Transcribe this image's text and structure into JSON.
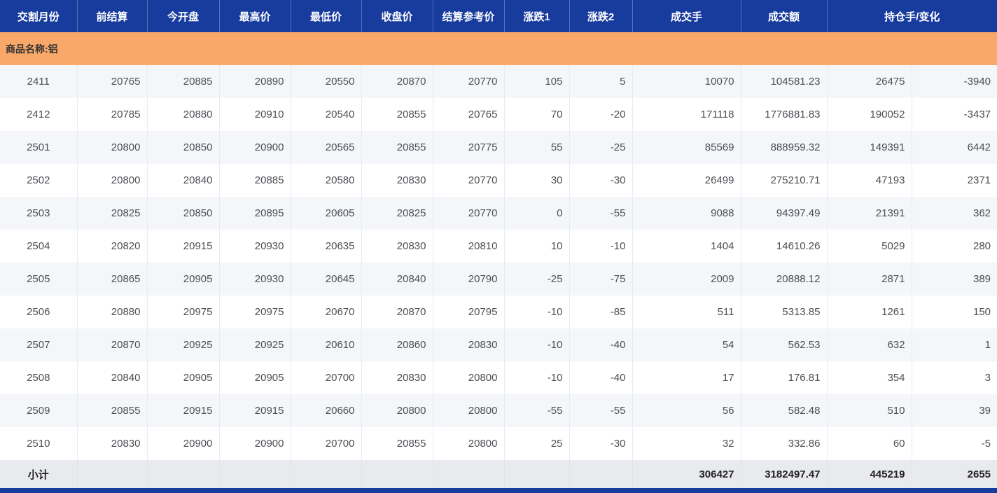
{
  "colors": {
    "header_bg": "#183b9e",
    "header_text": "#ffffff",
    "group_row_bg": "#f9a869",
    "row_alt_bg": "#f4f6fa",
    "row_bg": "#ffffff",
    "subtotal_bg": "#e9eaed",
    "cell_text": "#4c4f54"
  },
  "table": {
    "columns": [
      "交割月份",
      "前结算",
      "今开盘",
      "最高价",
      "最低价",
      "收盘价",
      "结算参考价",
      "涨跌1",
      "涨跌2",
      "成交手",
      "成交额",
      "持仓手/变化"
    ],
    "group_label": "商品名称:铝",
    "rows": [
      [
        "2411",
        "20765",
        "20885",
        "20890",
        "20550",
        "20870",
        "20770",
        "105",
        "5",
        "10070",
        "104581.23",
        "26475",
        "-3940"
      ],
      [
        "2412",
        "20785",
        "20880",
        "20910",
        "20540",
        "20855",
        "20765",
        "70",
        "-20",
        "171118",
        "1776881.83",
        "190052",
        "-3437"
      ],
      [
        "2501",
        "20800",
        "20850",
        "20900",
        "20565",
        "20855",
        "20775",
        "55",
        "-25",
        "85569",
        "888959.32",
        "149391",
        "6442"
      ],
      [
        "2502",
        "20800",
        "20840",
        "20885",
        "20580",
        "20830",
        "20770",
        "30",
        "-30",
        "26499",
        "275210.71",
        "47193",
        "2371"
      ],
      [
        "2503",
        "20825",
        "20850",
        "20895",
        "20605",
        "20825",
        "20770",
        "0",
        "-55",
        "9088",
        "94397.49",
        "21391",
        "362"
      ],
      [
        "2504",
        "20820",
        "20915",
        "20930",
        "20635",
        "20830",
        "20810",
        "10",
        "-10",
        "1404",
        "14610.26",
        "5029",
        "280"
      ],
      [
        "2505",
        "20865",
        "20905",
        "20930",
        "20645",
        "20840",
        "20790",
        "-25",
        "-75",
        "2009",
        "20888.12",
        "2871",
        "389"
      ],
      [
        "2506",
        "20880",
        "20975",
        "20975",
        "20670",
        "20870",
        "20795",
        "-10",
        "-85",
        "511",
        "5313.85",
        "1261",
        "150"
      ],
      [
        "2507",
        "20870",
        "20925",
        "20925",
        "20610",
        "20860",
        "20830",
        "-10",
        "-40",
        "54",
        "562.53",
        "632",
        "1"
      ],
      [
        "2508",
        "20840",
        "20905",
        "20905",
        "20700",
        "20830",
        "20800",
        "-10",
        "-40",
        "17",
        "176.81",
        "354",
        "3"
      ],
      [
        "2509",
        "20855",
        "20915",
        "20915",
        "20660",
        "20800",
        "20800",
        "-55",
        "-55",
        "56",
        "582.48",
        "510",
        "39"
      ],
      [
        "2510",
        "20830",
        "20900",
        "20900",
        "20700",
        "20855",
        "20800",
        "25",
        "-30",
        "32",
        "332.86",
        "60",
        "-5"
      ]
    ],
    "subtotal": {
      "label": "小计",
      "volume": "306427",
      "turnover": "3182497.47",
      "open_interest": "445219",
      "change": "2655"
    }
  }
}
